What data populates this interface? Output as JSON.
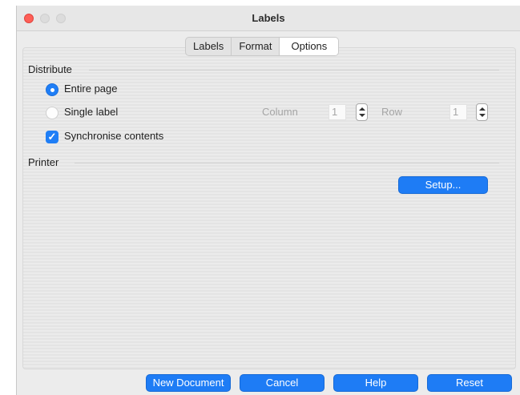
{
  "window": {
    "title": "Labels"
  },
  "tabs": [
    {
      "label": "Labels",
      "active": false
    },
    {
      "label": "Format",
      "active": false
    },
    {
      "label": "Options",
      "active": true
    }
  ],
  "distribute": {
    "heading": "Distribute",
    "entire_page": {
      "label": "Entire page",
      "selected": true
    },
    "single_label": {
      "label": "Single label",
      "selected": false
    },
    "column": {
      "label": "Column",
      "value": "1"
    },
    "row": {
      "label": "Row",
      "value": "1"
    },
    "synchronise": {
      "label": "Synchronise contents",
      "checked": true
    }
  },
  "printer": {
    "heading": "Printer",
    "setup_label": "Setup..."
  },
  "footer": {
    "new_document": "New Document",
    "cancel": "Cancel",
    "help": "Help",
    "reset": "Reset"
  },
  "colors": {
    "accent": "#1e7cf5",
    "close": "#fe5f57"
  },
  "icons": {
    "checkmark": "✓",
    "spinner": "stepper-up-down-icon"
  }
}
